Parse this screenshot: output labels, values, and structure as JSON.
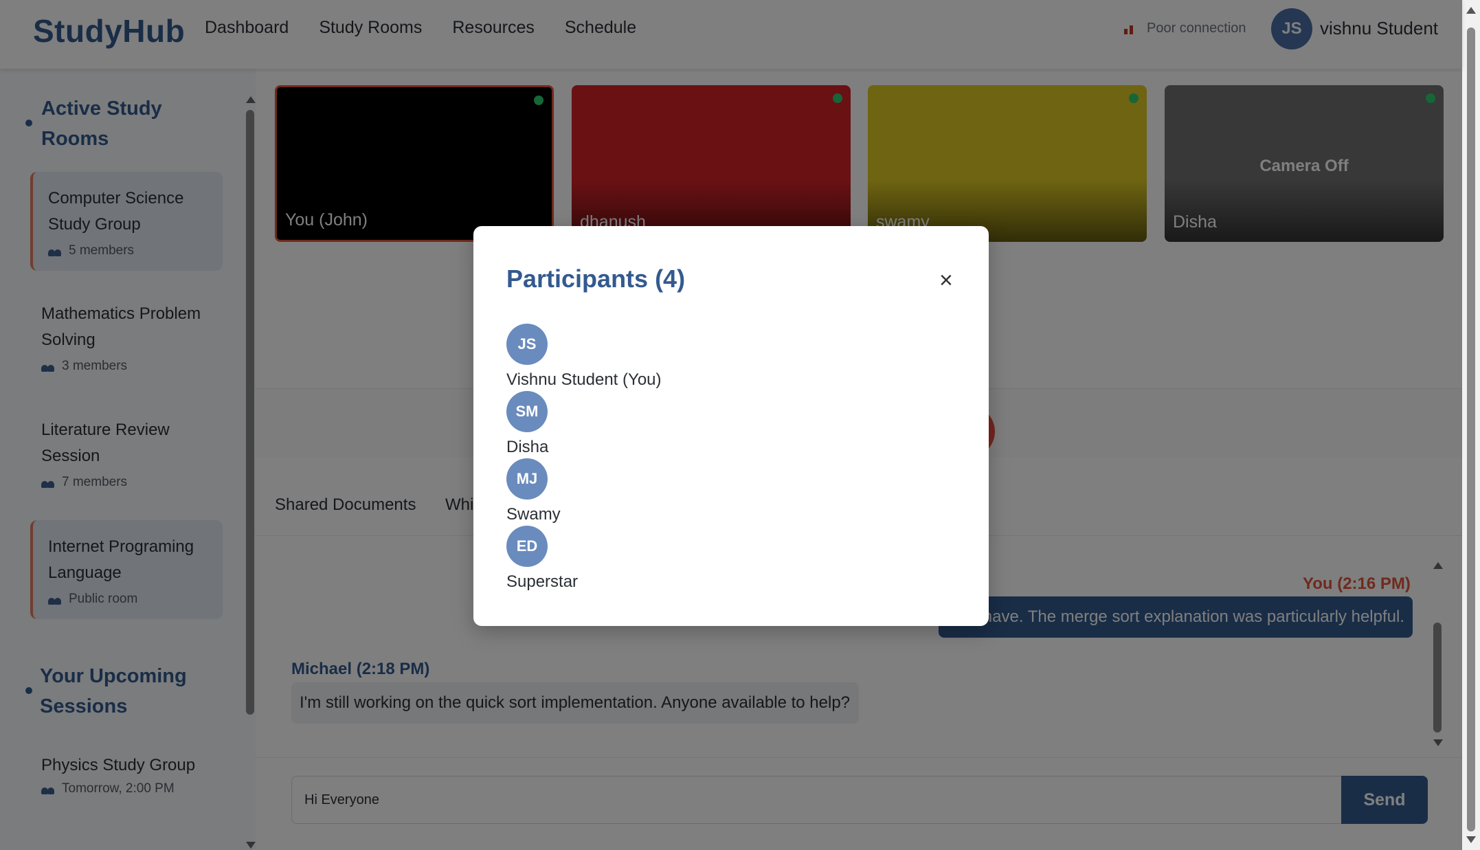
{
  "colors": {
    "brand": "#335a8f",
    "accent": "#e07a5f",
    "self_label": "#e0543b",
    "online": "#2ecc71",
    "poor_connection": "#c0392b"
  },
  "header": {
    "logo": "StudyHub",
    "nav": [
      "Dashboard",
      "Study Rooms",
      "Resources",
      "Schedule"
    ],
    "connection_status": "Poor connection",
    "user_initials": "JS",
    "user_name": "vishnu Student"
  },
  "sidebar": {
    "active_title": "Active Study Rooms",
    "rooms": [
      {
        "name": "Computer Science Study Group",
        "meta": "5 members",
        "active": true
      },
      {
        "name": "Mathematics Problem Solving",
        "meta": "3 members",
        "active": false
      },
      {
        "name": "Literature Review Session",
        "meta": "7 members",
        "active": false
      },
      {
        "name": "Internet Programing Language",
        "meta": "Public room",
        "active": true
      }
    ],
    "upcoming_title": "Your Upcoming Sessions",
    "upcoming": [
      {
        "name": "Physics Study Group",
        "meta": "Tomorrow, 2:00 PM"
      }
    ]
  },
  "videos": [
    {
      "name": "You (John)",
      "bg": "#000000",
      "camera_off": false
    },
    {
      "name": "dhanush",
      "bg": "#d42329",
      "camera_off": false
    },
    {
      "name": "swamy",
      "bg": "#dcc823",
      "camera_off": false
    },
    {
      "name": "Disha",
      "bg": "#707070",
      "camera_off": true,
      "camera_off_label": "Camera Off"
    }
  ],
  "tabs": [
    "Shared Documents",
    "Whi"
  ],
  "chat": {
    "messages": [
      {
        "sender": "You (2:16 PM)",
        "text": "have. The merge sort explanation was particularly helpful.",
        "self": true
      },
      {
        "sender": "Michael (2:18 PM)",
        "text": "I'm still working on the quick sort implementation. Anyone available to help?",
        "self": false
      }
    ],
    "input_value": "Hi Everyone",
    "send_label": "Send"
  },
  "modal": {
    "title": "Participants (4)",
    "close_glyph": "×",
    "participants": [
      {
        "initials": "JS",
        "name": "Vishnu Student (You)"
      },
      {
        "initials": "SM",
        "name": "Disha"
      },
      {
        "initials": "MJ",
        "name": "Swamy"
      },
      {
        "initials": "ED",
        "name": "Superstar"
      }
    ]
  }
}
